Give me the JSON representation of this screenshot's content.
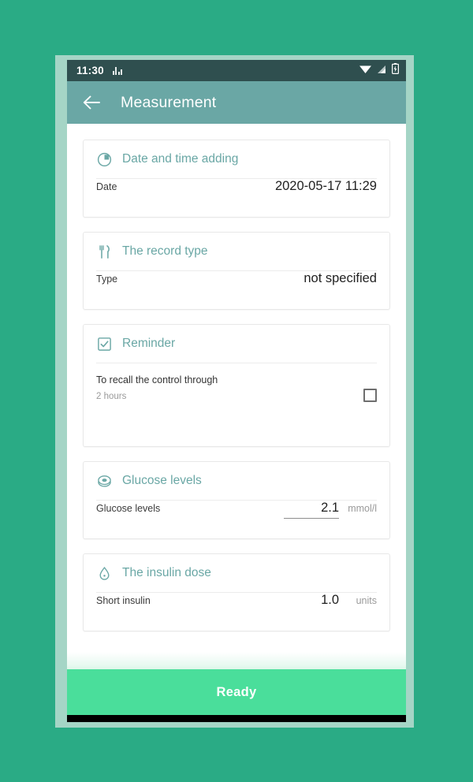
{
  "theme": {
    "page_background": "#2aab85",
    "frame_color": "#a5d5c6",
    "status_bar_color": "#2f4f4f",
    "app_bar_color": "#6aa7a5",
    "accent_color": "#6aa7a5",
    "ready_button_color": "#4ade9b"
  },
  "status_bar": {
    "time": "11:30",
    "equalizer_icon": "equalizer-icon",
    "wifi_icon": "wifi-icon",
    "signal_icon": "signal-icon",
    "battery_icon": "battery-charging-icon"
  },
  "app_bar": {
    "back_icon": "back-arrow-icon",
    "title": "Measurement"
  },
  "cards": [
    {
      "id": "date-time-adding",
      "icon": "clock-icon",
      "title": "Date and time adding",
      "rows": [
        {
          "label": "Date",
          "value": "2020-05-17 11:29"
        }
      ]
    },
    {
      "id": "record-type",
      "icon": "cutlery-icon",
      "title": "The record type",
      "rows": [
        {
          "label": "Type",
          "value": "not specified"
        }
      ]
    },
    {
      "id": "reminder",
      "icon": "checkbox-check-icon",
      "title": "Reminder",
      "main_text": "To recall the control through",
      "sub_text": "2 hours",
      "checkbox_checked": false
    },
    {
      "id": "glucose-levels",
      "icon": "glucose-meter-icon",
      "title": "Glucose levels",
      "rows": [
        {
          "label": "Glucose levels",
          "value": "2.1",
          "unit": "mmol/l"
        }
      ]
    },
    {
      "id": "insulin-dose",
      "icon": "droplet-icon",
      "title": "The insulin dose",
      "rows": [
        {
          "label": "Short insulin",
          "value": "1.0",
          "unit": "units"
        }
      ]
    }
  ],
  "footer": {
    "ready_label": "Ready"
  }
}
